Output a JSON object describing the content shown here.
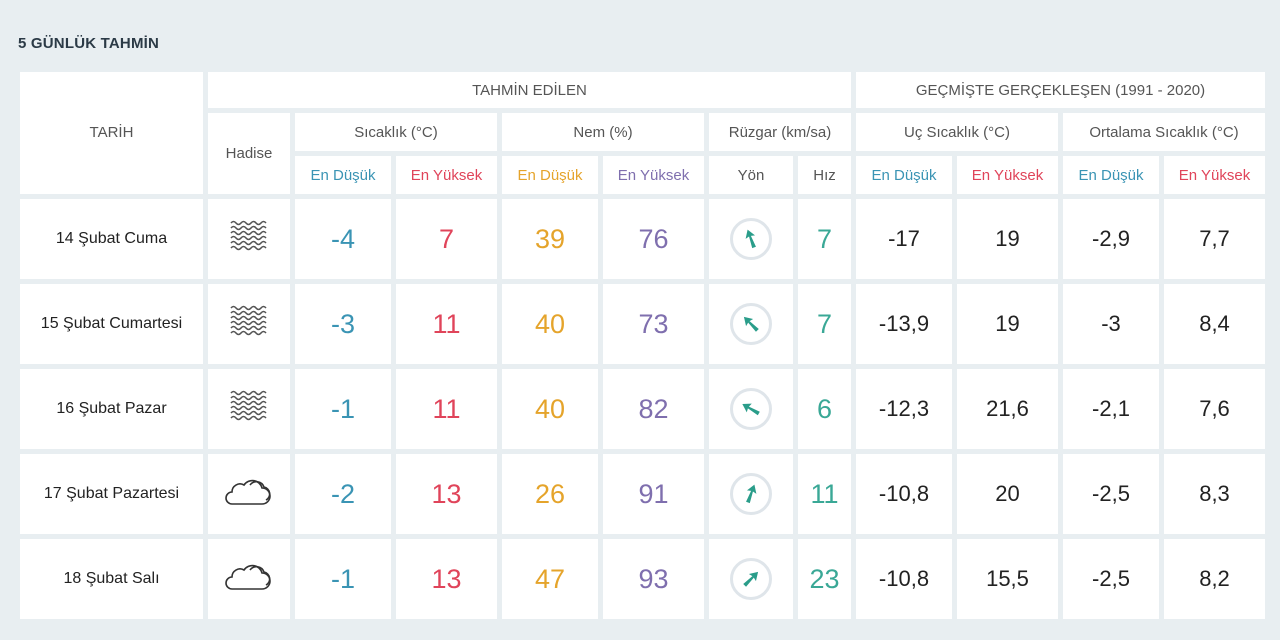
{
  "section_title": "5 GÜNLÜK TAHMİN",
  "headers": {
    "tarih": "TARİH",
    "predicted": "TAHMİN EDİLEN",
    "historical": "GEÇMİŞTE GERÇEKLEŞEN (1991 - 2020)",
    "hadise": "Hadise",
    "temp": "Sıcaklık (°C)",
    "humidity": "Nem (%)",
    "wind": "Rüzgar (km/sa)",
    "extreme_temp": "Uç Sıcaklık (°C)",
    "avg_temp": "Ortalama Sıcaklık (°C)",
    "min": "En Düşük",
    "max": "En Yüksek",
    "direction": "Yön",
    "speed": "Hız"
  },
  "colors": {
    "min_temp": "#3a94b4",
    "max_temp": "#e0445a",
    "min_hum": "#e5a42b",
    "max_hum": "#7f6fae",
    "wind": "#3aa896"
  },
  "rows": [
    {
      "date": "14 Şubat Cuma",
      "icon": "fog-icon",
      "temp_min": "-4",
      "temp_max": "7",
      "hum_min": "39",
      "hum_max": "76",
      "wind_dir_deg": 340,
      "wind_speed": "7",
      "ext_min": "-17",
      "ext_max": "19",
      "avg_min": "-2,9",
      "avg_max": "7,7"
    },
    {
      "date": "15 Şubat Cumartesi",
      "icon": "fog-icon",
      "temp_min": "-3",
      "temp_max": "11",
      "hum_min": "40",
      "hum_max": "73",
      "wind_dir_deg": 315,
      "wind_speed": "7",
      "ext_min": "-13,9",
      "ext_max": "19",
      "avg_min": "-3",
      "avg_max": "8,4"
    },
    {
      "date": "16 Şubat Pazar",
      "icon": "fog-icon",
      "temp_min": "-1",
      "temp_max": "11",
      "hum_min": "40",
      "hum_max": "82",
      "wind_dir_deg": 300,
      "wind_speed": "6",
      "ext_min": "-12,3",
      "ext_max": "21,6",
      "avg_min": "-2,1",
      "avg_max": "7,6"
    },
    {
      "date": "17 Şubat Pazartesi",
      "icon": "cloud-icon",
      "temp_min": "-2",
      "temp_max": "13",
      "hum_min": "26",
      "hum_max": "91",
      "wind_dir_deg": 20,
      "wind_speed": "11",
      "ext_min": "-10,8",
      "ext_max": "20",
      "avg_min": "-2,5",
      "avg_max": "8,3"
    },
    {
      "date": "18 Şubat Salı",
      "icon": "cloud-icon",
      "temp_min": "-1",
      "temp_max": "13",
      "hum_min": "47",
      "hum_max": "93",
      "wind_dir_deg": 45,
      "wind_speed": "23",
      "ext_min": "-10,8",
      "ext_max": "15,5",
      "avg_min": "-2,5",
      "avg_max": "8,2"
    }
  ]
}
